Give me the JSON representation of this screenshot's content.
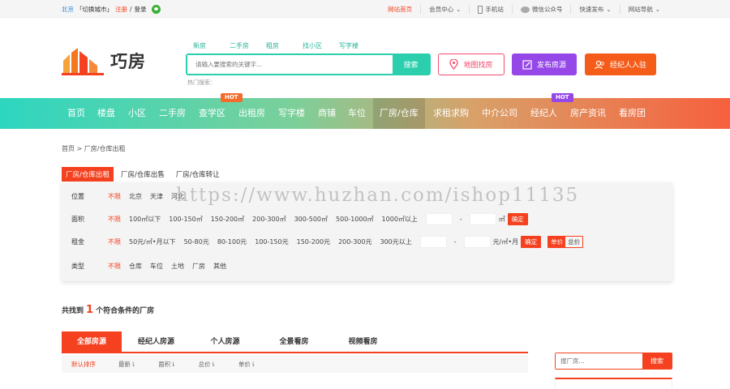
{
  "topbar": {
    "city": "北京",
    "switch_city": "「切换城市」",
    "register": "注册",
    "sep": "/",
    "login": "登录",
    "links": [
      "网站首页",
      "会员中心",
      "手机站",
      "微信公众号",
      "快速发布",
      "网站导航"
    ]
  },
  "logo": {
    "text": "巧房"
  },
  "search": {
    "tabs": [
      "新房",
      "二手房",
      "租房",
      "找小区",
      "写字楼"
    ],
    "placeholder": "请输入要搜索的关键字...",
    "button": "搜索",
    "hot_label": "热门搜索："
  },
  "actions": {
    "map": "地图找房",
    "publish": "发布房源",
    "agent": "经纪人入驻"
  },
  "nav": {
    "items": [
      "首页",
      "楼盘",
      "小区",
      "二手房",
      "查学区",
      "出租房",
      "写字楼",
      "商铺",
      "车位",
      "厂房/仓库",
      "求租求购",
      "中介公司",
      "经纪人",
      "房产资讯",
      "看房团"
    ],
    "hot": "HOT"
  },
  "breadcrumb": "首页 > 厂房/仓库出租",
  "page_tabs": [
    "厂房/仓库出租",
    "厂房/仓库出售",
    "厂房/仓库转让"
  ],
  "filters": {
    "location": {
      "label": "位置",
      "options": [
        "不限",
        "北京",
        "天津",
        "河北"
      ]
    },
    "area": {
      "label": "面积",
      "options": [
        "不限",
        "100㎡以下",
        "100-150㎡",
        "150-200㎡",
        "200-300㎡",
        "300-500㎡",
        "500-1000㎡",
        "1000㎡以上"
      ],
      "dash": "-",
      "unit": "㎡",
      "confirm": "确定"
    },
    "rent": {
      "label": "租金",
      "options": [
        "不限",
        "50元/㎡•月以下",
        "50-80元",
        "80-100元",
        "100-150元",
        "150-200元",
        "200-300元",
        "300元以上"
      ],
      "dash": "-",
      "unit": "元/㎡•月",
      "confirm": "确定",
      "seg": [
        "单价",
        "总价"
      ]
    },
    "type": {
      "label": "类型",
      "options": [
        "不限",
        "仓库",
        "车位",
        "土地",
        "厂房",
        "其他"
      ]
    }
  },
  "result": {
    "prefix": "共找到",
    "count": "1",
    "suffix": "个符合条件的厂房"
  },
  "list_tabs": [
    "全部房源",
    "经纪人房源",
    "个人房源",
    "全景看房",
    "视频看房"
  ],
  "sort": [
    "默认排序",
    "最新⇂",
    "面积⇂",
    "总价⇂",
    "单价⇂"
  ],
  "side_search": {
    "placeholder": "搜厂房...",
    "button": "搜索"
  },
  "watermark": "https://www.huzhan.com/ishop11135",
  "colors": {
    "accent": "#f5411f",
    "teal": "#2bcfad",
    "purple": "#9547e8"
  }
}
